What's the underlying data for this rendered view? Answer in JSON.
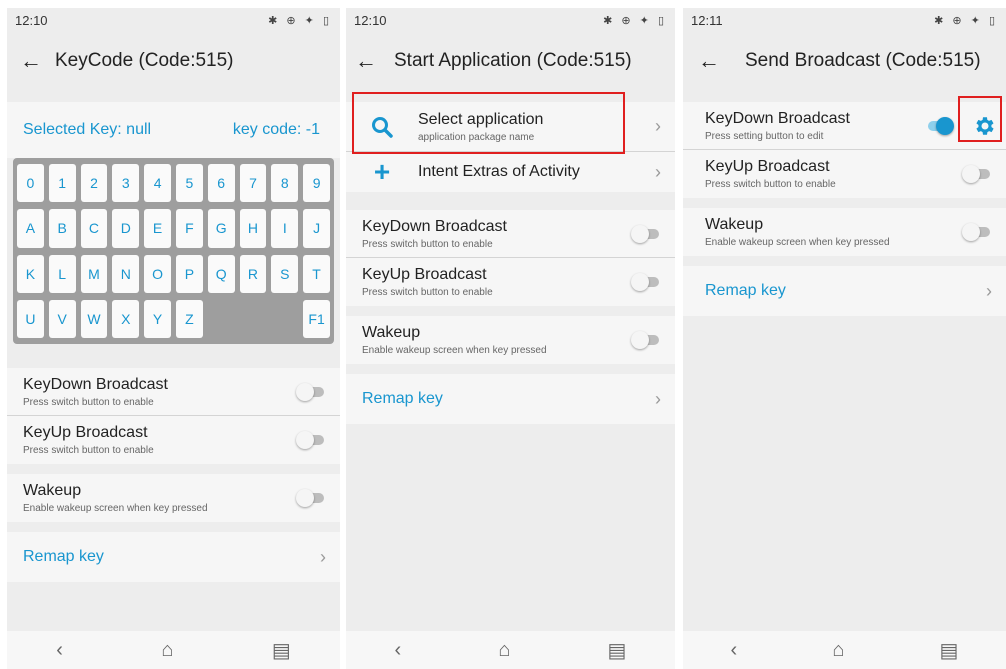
{
  "phone1": {
    "status": {
      "time": "12:10",
      "icons": "✱ ⊕ ✦ ▯"
    },
    "title": "KeyCode (Code:515)",
    "selected_key": "Selected Key: null",
    "key_code": "key code: -1",
    "keys": [
      "0",
      "1",
      "2",
      "3",
      "4",
      "5",
      "6",
      "7",
      "8",
      "9",
      "A",
      "B",
      "C",
      "D",
      "E",
      "F",
      "G",
      "H",
      "I",
      "J",
      "K",
      "L",
      "M",
      "N",
      "O",
      "P",
      "Q",
      "R",
      "S",
      "T",
      "U",
      "V",
      "W",
      "X",
      "Y",
      "Z",
      "F1"
    ],
    "keydown": {
      "label": "KeyDown Broadcast",
      "sub": "Press switch button to enable",
      "on": false
    },
    "keyup": {
      "label": "KeyUp Broadcast",
      "sub": "Press switch button to enable",
      "on": false
    },
    "wakeup": {
      "label": "Wakeup",
      "sub": "Enable wakeup screen when key pressed",
      "on": false
    },
    "remap": "Remap key"
  },
  "phone2": {
    "status": {
      "time": "12:10",
      "icons": "✱ ⊕ ✦ ▯"
    },
    "title": "Start Application (Code:515)",
    "select_app": {
      "label": "Select application",
      "sub": "application package name"
    },
    "intent": "Intent Extras of Activity",
    "keydown": {
      "label": "KeyDown Broadcast",
      "sub": "Press switch button to enable",
      "on": false
    },
    "keyup": {
      "label": "KeyUp Broadcast",
      "sub": "Press switch button to enable",
      "on": false
    },
    "wakeup": {
      "label": "Wakeup",
      "sub": "Enable wakeup screen when key pressed",
      "on": false
    },
    "remap": "Remap key"
  },
  "phone3": {
    "status": {
      "time": "12:11",
      "icons": "✱ ⊕ ✦ ▯"
    },
    "title": "Send Broadcast (Code:515)",
    "keydown": {
      "label": "KeyDown Broadcast",
      "sub": "Press setting button to edit",
      "on": true
    },
    "keyup": {
      "label": "KeyUp Broadcast",
      "sub": "Press switch button to enable",
      "on": false
    },
    "wakeup": {
      "label": "Wakeup",
      "sub": "Enable wakeup screen when key pressed",
      "on": false
    },
    "remap": "Remap key"
  },
  "icons": {
    "back": "←",
    "chevron": "›",
    "nav_back": "‹",
    "nav_home": "⌂",
    "nav_recent": "▤",
    "plus": "+"
  },
  "colors": {
    "accent": "#1996cf",
    "highlight": "#e01f1f",
    "background": "#ededed"
  }
}
